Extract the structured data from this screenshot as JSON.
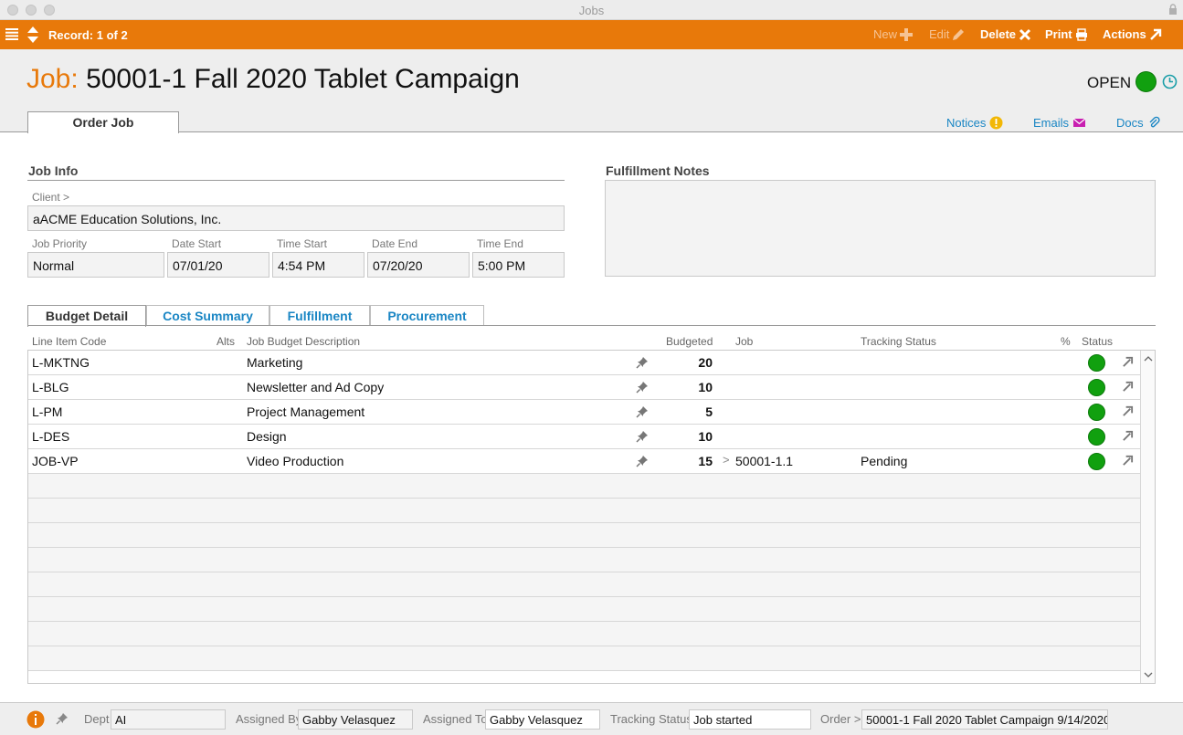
{
  "window": {
    "title": "Jobs"
  },
  "toolbar": {
    "record": "Record: 1 of 2",
    "new_label": "New",
    "edit_label": "Edit",
    "delete_label": "Delete",
    "print_label": "Print",
    "actions_label": "Actions"
  },
  "header": {
    "job_label": "Job:",
    "job_name": "50001-1 Fall 2020 Tablet Campaign",
    "status": "OPEN",
    "tab": "Order Job",
    "links": {
      "notices": "Notices",
      "emails": "Emails",
      "docs": "Docs"
    }
  },
  "job_info": {
    "title": "Job Info",
    "client_label": "Client >",
    "client": "aACME Education Solutions, Inc.",
    "priority_label": "Job Priority",
    "priority": "Normal",
    "date_start_label": "Date Start",
    "date_start": "07/01/20",
    "time_start_label": "Time Start",
    "time_start": "4:54 PM",
    "date_end_label": "Date End",
    "date_end": "07/20/20",
    "time_end_label": "Time End",
    "time_end": "5:00 PM"
  },
  "fulfillment_notes": {
    "title": "Fulfillment Notes"
  },
  "budget_tabs": [
    "Budget Detail",
    "Cost Summary",
    "Fulfillment",
    "Procurement"
  ],
  "columns": {
    "code": "Line Item Code",
    "alts": "Alts",
    "description": "Job Budget Description",
    "budgeted": "Budgeted",
    "job": "Job",
    "tracking": "Tracking Status",
    "percent": "%",
    "status": "Status"
  },
  "rows": [
    {
      "code": "L-MKTNG",
      "description": "Marketing",
      "budgeted": "20",
      "job": "",
      "tracking": ""
    },
    {
      "code": "L-BLG",
      "description": "Newsletter and Ad Copy",
      "budgeted": "10",
      "job": "",
      "tracking": ""
    },
    {
      "code": "L-PM",
      "description": "Project Management",
      "budgeted": "5",
      "job": "",
      "tracking": ""
    },
    {
      "code": "L-DES",
      "description": "Design",
      "budgeted": "10",
      "job": "",
      "tracking": ""
    },
    {
      "code": "JOB-VP",
      "description": "Video Production",
      "budgeted": "15",
      "job": "50001-1.1",
      "tracking": "Pending",
      "job_chevron": ">"
    }
  ],
  "footer": {
    "dept_label": "Dept",
    "dept": "AI",
    "assigned_by_label": "Assigned By",
    "assigned_by": "Gabby Velasquez",
    "assigned_to_label": "Assigned To",
    "assigned_to": "Gabby Velasquez",
    "tracking_label": "Tracking Status",
    "tracking": "Job started",
    "order_label": "Order >",
    "order": "50001-1 Fall 2020 Tablet Campaign  9/14/2020"
  },
  "colors": {
    "accent": "#e8790a",
    "link": "#1a86c4",
    "status_green": "#11a00f"
  }
}
